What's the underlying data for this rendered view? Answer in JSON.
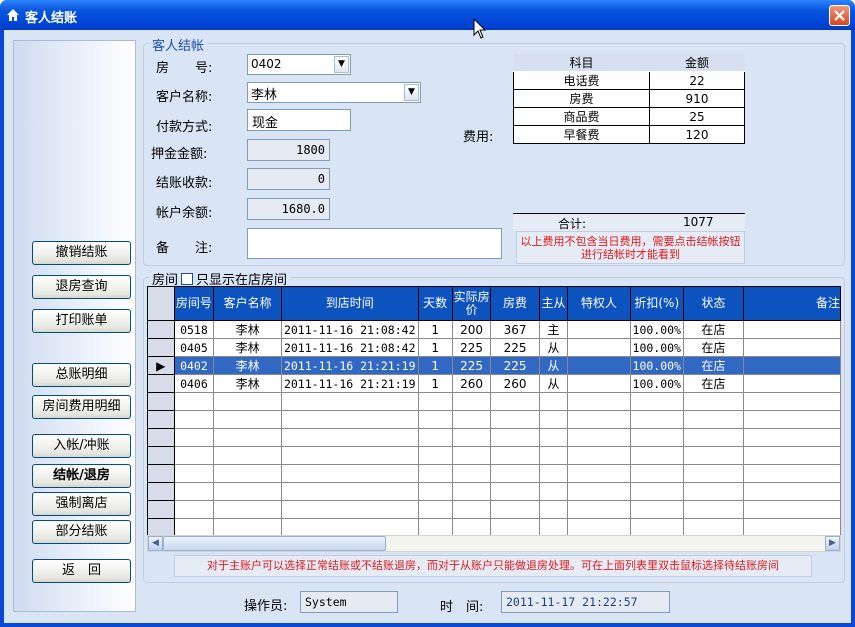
{
  "window": {
    "title": "客人结账"
  },
  "sidebar": {
    "buttons": [
      "撤销结账",
      "退房查询",
      "打印账单",
      "总账明细",
      "房间费用明细",
      "入帐/冲账",
      "结帐/退房",
      "强制离店",
      "部分结账",
      "返　回"
    ]
  },
  "guest_group": {
    "title": "客人结帐",
    "room_no_label": "房　　号:",
    "room_no_value": "0402",
    "customer_label": "客户名称:",
    "customer_value": "李林",
    "payment_label": "付款方式:",
    "payment_value": "现金",
    "deposit_label": "押金金额:",
    "deposit_value": "1800",
    "checkout_label": "结账收款:",
    "checkout_value": "0",
    "balance_label": "帐户余额:",
    "balance_value": "1680.0",
    "remark_label": "备　　注:",
    "remark_value": "",
    "fee_label": "费用:"
  },
  "fees": {
    "headers": [
      "科目",
      "金额"
    ],
    "rows": [
      {
        "item": "电话费",
        "amount": "22"
      },
      {
        "item": "房费",
        "amount": "910"
      },
      {
        "item": "商品费",
        "amount": "25"
      },
      {
        "item": "早餐费",
        "amount": "120"
      }
    ],
    "total_label": "合计:",
    "total_value": "1077",
    "notice": "以上费用不包含当日费用，需要点击结帐按钮进行结帐时才能看到"
  },
  "room_group": {
    "title": "房间",
    "checkbox_label": "只显示在店房间",
    "columns": [
      "房间号",
      "客户名称",
      "到店时间",
      "天数",
      "实际房价",
      "房费",
      "主从",
      "特权人",
      "折扣(%)",
      "状态",
      "备注"
    ],
    "rows": [
      {
        "room": "0518",
        "name": "李林",
        "time": "2011-11-16 21:08:42",
        "days": "1",
        "price": "200",
        "fee": "367",
        "role": "主",
        "priv": "",
        "disc": "100.00%",
        "state": "在店",
        "selected": false
      },
      {
        "room": "0405",
        "name": "李林",
        "time": "2011-11-16 21:08:42",
        "days": "1",
        "price": "225",
        "fee": "225",
        "role": "从",
        "priv": "",
        "disc": "100.00%",
        "state": "在店",
        "selected": false
      },
      {
        "room": "0402",
        "name": "李林",
        "time": "2011-11-16 21:21:19",
        "days": "1",
        "price": "225",
        "fee": "225",
        "role": "从",
        "priv": "",
        "disc": "100.00%",
        "state": "在店",
        "selected": true
      },
      {
        "room": "0406",
        "name": "李林",
        "time": "2011-11-16 21:21:19",
        "days": "1",
        "price": "260",
        "fee": "260",
        "role": "从",
        "priv": "",
        "disc": "100.00%",
        "state": "在店",
        "selected": false
      }
    ],
    "empty_rows": 8,
    "tip": "对于主账户可以选择正常结账或不结账退房，而对于从账户只能做退房处理。可在上面列表里双击鼠标选择待结账房间"
  },
  "status": {
    "operator_label": "操作员:",
    "operator_value": "System",
    "time_label": "时　间:",
    "time_value": "2011-11-17 21:22:57"
  },
  "colors": {
    "title_bar": "#0a46d8",
    "client_bg": "#d9e4f5",
    "grid_header": "#0d53c0",
    "selection": "#3168c3",
    "warning_text": "#e0191b"
  }
}
